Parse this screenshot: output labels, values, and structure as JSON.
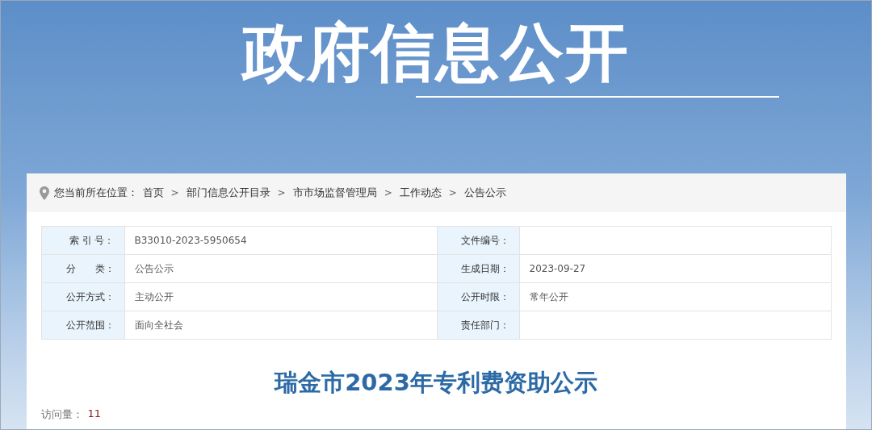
{
  "banner": {
    "title": "政府信息公开"
  },
  "breadcrumb": {
    "label": "您当前所在位置：",
    "items": [
      {
        "kind": "link",
        "text": "首页"
      },
      {
        "kind": "separator",
        "text": ">"
      },
      {
        "kind": "link",
        "text": "部门信息公开目录"
      },
      {
        "kind": "separator",
        "text": ">"
      },
      {
        "kind": "link",
        "text": "市市场监督管理局"
      },
      {
        "kind": "separator",
        "text": ">"
      },
      {
        "kind": "link",
        "text": "工作动态"
      },
      {
        "kind": "separator",
        "text": ">"
      },
      {
        "kind": "link",
        "text": "公告公示"
      }
    ]
  },
  "info_table": {
    "rows": [
      [
        {
          "label": "索 引 号：",
          "value": "B33010-2023-5950654"
        },
        {
          "label": "文件编号："
        }
      ],
      [
        {
          "label": "分　　类：",
          "value": "公告公示"
        },
        {
          "label": "生成日期：",
          "value": "2023-09-27"
        }
      ],
      [
        {
          "label": "公开方式：",
          "value": "主动公开"
        },
        {
          "label": "公开时限：",
          "value": "常年公开"
        }
      ],
      [
        {
          "label": "公开范围：",
          "value": "面向全社会"
        },
        {
          "label": "责任部门："
        }
      ]
    ]
  },
  "article": {
    "title": "瑞金市2023年专利费资助公示",
    "views_label": "访问量：",
    "views": "11"
  }
}
